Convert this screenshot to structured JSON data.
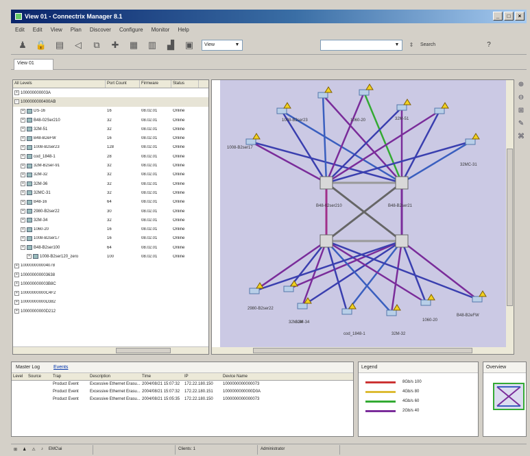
{
  "window": {
    "title": "View 01 - Connectrix Manager 8.1"
  },
  "menu": [
    "Edit",
    "Edit",
    "View",
    "Plan",
    "Discover",
    "Configure",
    "Monitor",
    "Help"
  ],
  "toolbar": {
    "view_value": "View",
    "search_label": "Search",
    "help_label": "?"
  },
  "tab": {
    "label": "View 01"
  },
  "tree": {
    "columns": [
      "All Levels",
      "Port Count",
      "Firmware",
      "Status"
    ],
    "rows": [
      {
        "name": "100000000003A",
        "port": "",
        "firm": "",
        "stat": "",
        "level": 0
      },
      {
        "name": "1000000000400AB",
        "port": "",
        "firm": "",
        "stat": "",
        "level": 0
      },
      {
        "name": "DS-16",
        "port": "16",
        "firm": "08.02.01",
        "stat": "Online",
        "level": 1
      },
      {
        "name": "B48-02Ser210",
        "port": "32",
        "firm": "08.02.01",
        "stat": "Online",
        "level": 1
      },
      {
        "name": "32M-51",
        "port": "32",
        "firm": "08.02.01",
        "stat": "Online",
        "level": 1
      },
      {
        "name": "B48-B2eFW",
        "port": "16",
        "firm": "08.02.01",
        "stat": "Online",
        "level": 1
      },
      {
        "name": "1008-B2ser23",
        "port": "128",
        "firm": "08.02.01",
        "stat": "Online",
        "level": 1
      },
      {
        "name": "cod_1848-1",
        "port": "28",
        "firm": "08.02.01",
        "stat": "Online",
        "level": 1
      },
      {
        "name": "32M-B2ser-91",
        "port": "32",
        "firm": "08.02.01",
        "stat": "Online",
        "level": 1
      },
      {
        "name": "32M-32",
        "port": "32",
        "firm": "08.02.01",
        "stat": "Online",
        "level": 1
      },
      {
        "name": "32M-36",
        "port": "32",
        "firm": "08.02.01",
        "stat": "Online",
        "level": 1
      },
      {
        "name": "32MC-31",
        "port": "32",
        "firm": "08.02.01",
        "stat": "Online",
        "level": 1
      },
      {
        "name": "B48-16",
        "port": "64",
        "firm": "08.02.01",
        "stat": "Online",
        "level": 1
      },
      {
        "name": "2980-B2ser22",
        "port": "30",
        "firm": "08.02.01",
        "stat": "Online",
        "level": 1
      },
      {
        "name": "32M-34",
        "port": "32",
        "firm": "08.02.01",
        "stat": "Online",
        "level": 1
      },
      {
        "name": "1060-20",
        "port": "16",
        "firm": "08.02.01",
        "stat": "Online",
        "level": 1
      },
      {
        "name": "1008-B2ser17",
        "port": "16",
        "firm": "08.02.01",
        "stat": "Online",
        "level": 1
      },
      {
        "name": "B48-B2ser100",
        "port": "64",
        "firm": "08.02.01",
        "stat": "Online",
        "level": 1
      },
      {
        "name": "1008-B2ser120_zero",
        "port": "100",
        "firm": "08.02.01",
        "stat": "Online",
        "level": 2
      },
      {
        "name": "100000000004078",
        "port": "",
        "firm": "",
        "stat": "",
        "level": 0
      },
      {
        "name": "100000000003638",
        "port": "",
        "firm": "",
        "stat": "",
        "level": 0
      },
      {
        "name": "100000000003B8C",
        "port": "",
        "firm": "",
        "stat": "",
        "level": 0
      },
      {
        "name": "10000000000C4F2",
        "port": "",
        "firm": "",
        "stat": "",
        "level": 0
      },
      {
        "name": "10000000000D382",
        "port": "",
        "firm": "",
        "stat": "",
        "level": 0
      },
      {
        "name": "10000000000D212",
        "port": "",
        "firm": "",
        "stat": "",
        "level": 0
      }
    ]
  },
  "topology": {
    "node_labels": [
      "1008-B2ser23",
      "32M-51",
      "1060-20",
      "1008-B2ser17",
      "32MC-31",
      "32M-34",
      "B48-02ser210",
      "B48-B2ser21",
      "2980-B2ser22",
      "32M-34",
      "cod_1848-1",
      "32M-32",
      "1060-20",
      "B48-B2eFW"
    ]
  },
  "events": {
    "tabs": [
      "Master Log",
      "Events"
    ],
    "columns": [
      "Level",
      "Source",
      "Trap",
      "Description",
      "Time",
      "IP",
      "Device Name"
    ],
    "rows": [
      [
        "",
        "",
        "Product Event",
        "Excessive Ethernet Erasu...",
        "2004/08/21 15:07:32",
        "172.22.180.150",
        "1000000000000073"
      ],
      [
        "",
        "",
        "Product Event",
        "Excessive Ethernet Erasu...",
        "2004/08/21 15:07:32",
        "172.22.180.151",
        "1000000000000D0A"
      ],
      [
        "",
        "",
        "Product Event",
        "Excessive Ethernet Erasu...",
        "2004/08/21 15:05:35",
        "172.22.180.150",
        "1000000000000073"
      ]
    ]
  },
  "legend": {
    "title": "Legend",
    "items": [
      {
        "label": "8Gb/s 100",
        "color": "#cc3333"
      },
      {
        "label": "4Gb/s 80",
        "color": "#ddbb33"
      },
      {
        "label": "4Gb/s 60",
        "color": "#33aa33"
      },
      {
        "label": "2Gb/s 40",
        "color": "#7a2c9a"
      }
    ]
  },
  "overview": {
    "title": "Overview"
  },
  "status": {
    "user_label": "EMC\\ai",
    "clients_label": "Clients: 1",
    "role_label": "Administrator"
  }
}
